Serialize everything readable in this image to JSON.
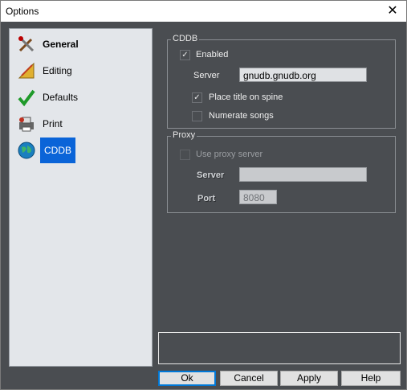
{
  "window": {
    "title": "Options",
    "close_icon": "close-icon"
  },
  "sidebar": {
    "items": [
      {
        "label": "General",
        "icon": "tools-icon",
        "bold": true
      },
      {
        "label": "Editing",
        "icon": "ruler-pencil-icon"
      },
      {
        "label": "Defaults",
        "icon": "green-checkmark-icon"
      },
      {
        "label": "Print",
        "icon": "printer-icon"
      },
      {
        "label": "CDDB",
        "icon": "globe-icon",
        "selected": true
      }
    ]
  },
  "cddb": {
    "legend": "CDDB",
    "enabled": {
      "label": "Enabled",
      "checked": true
    },
    "server_label": "Server",
    "server_value": "gnudb.gnudb.org",
    "place_title": {
      "label": "Place title on spine",
      "checked": true
    },
    "numerate": {
      "label": "Numerate songs",
      "checked": false
    }
  },
  "proxy": {
    "legend": "Proxy",
    "use_proxy": {
      "label": "Use proxy server",
      "checked": false,
      "disabled": true
    },
    "server_label": "Server",
    "server_value": "",
    "port_label": "Port",
    "port_value": "8080"
  },
  "buttons": {
    "ok": "Ok",
    "cancel": "Cancel",
    "apply": "Apply",
    "help": "Help"
  },
  "colors": {
    "selection": "#0a64d8",
    "panel_bg": "#4a4d51",
    "sidebar_bg": "#e3e6ea"
  }
}
